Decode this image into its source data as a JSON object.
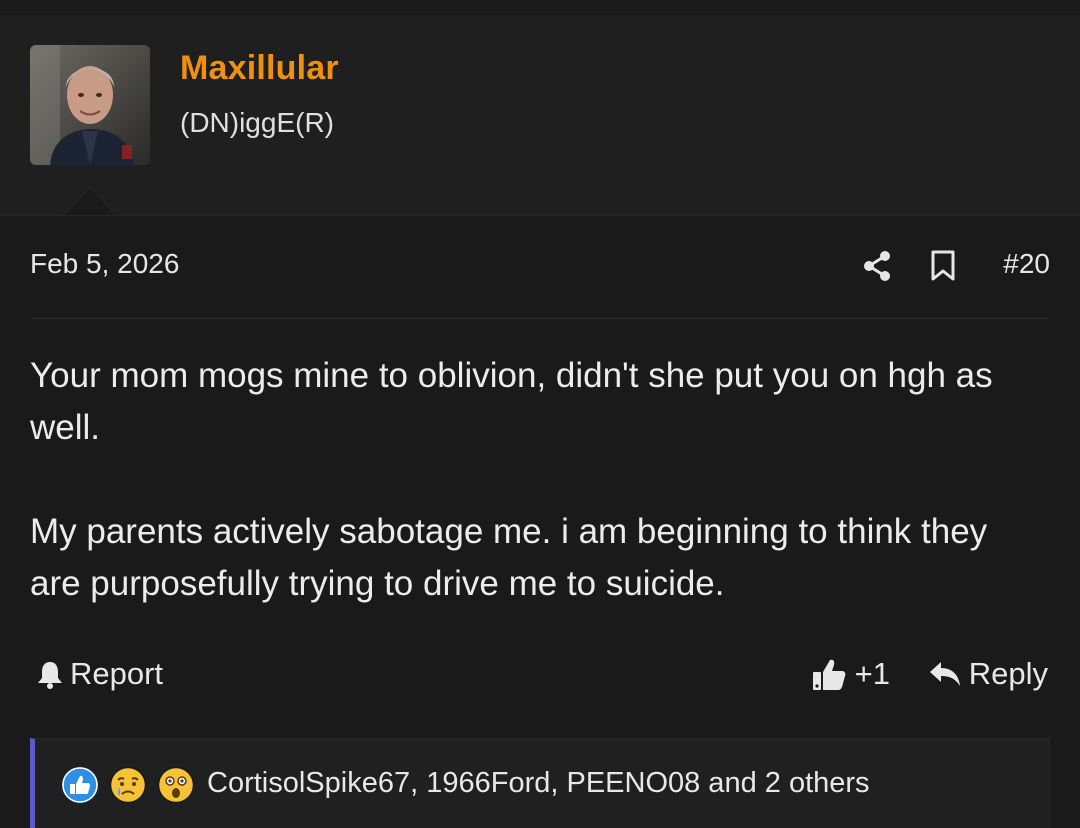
{
  "user": {
    "username": "Maxillular",
    "title": "(DN)iggE(R)"
  },
  "post": {
    "date": "Feb 5, 2026",
    "number": "#20",
    "paragraphs": [
      "Your mom mogs mine to oblivion, didn't she put you on hgh as well.",
      "My parents actively sabotage me. i am beginning to think they are purposefully trying to drive me to suicide."
    ]
  },
  "actions": {
    "report_label": "Report",
    "like_count": "+1",
    "reply_label": "Reply"
  },
  "reactions": {
    "icons": [
      "like-reaction-icon",
      "sad-reaction-icon",
      "wow-reaction-icon"
    ],
    "text": "CortisolSpike67, 1966Ford, PEENO08 and 2 others"
  },
  "colors": {
    "background": "#1a1a1a",
    "header_background": "#1f1f1f",
    "username": "#f0900f",
    "reaction_accent": "#5a5ac8",
    "like_blue": "#2f8fe6"
  }
}
